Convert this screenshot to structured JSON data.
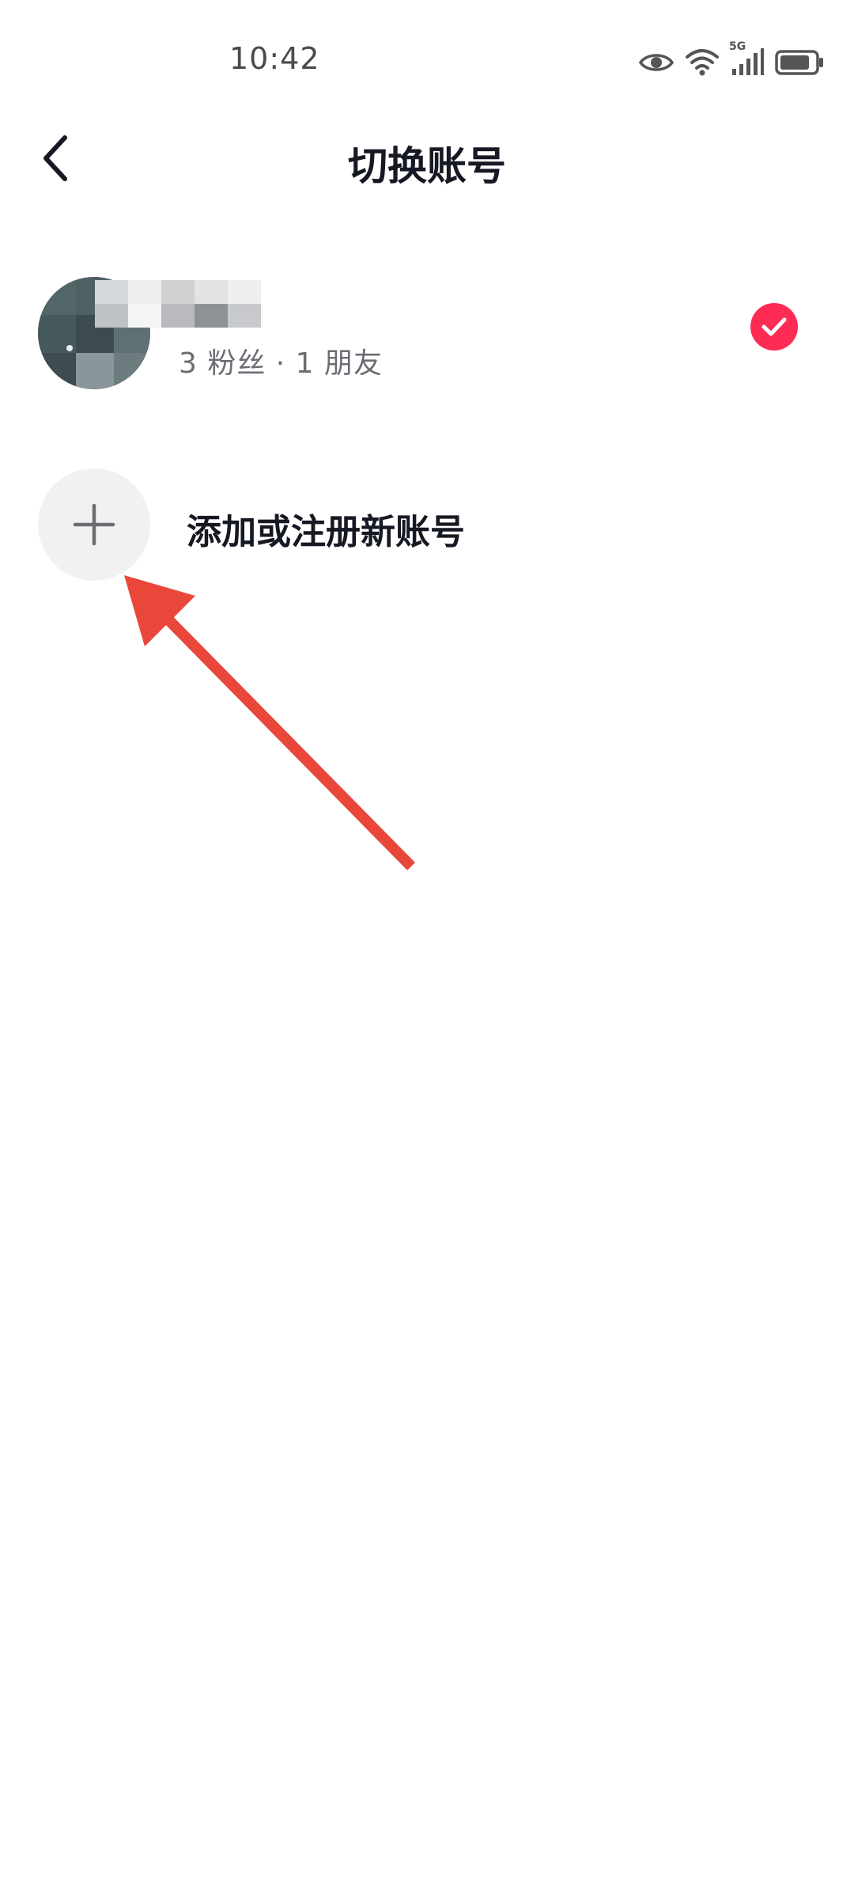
{
  "status_bar": {
    "time": "10:42",
    "icons": [
      "eye-icon",
      "wifi-icon",
      "5g-icon",
      "signal-icon",
      "battery-icon"
    ],
    "network_label": "5G"
  },
  "header": {
    "title": "切换账号",
    "back_icon": "chevron-left-icon"
  },
  "accounts": [
    {
      "stats": "3 粉丝 · 1 朋友",
      "selected": true
    }
  ],
  "add_account": {
    "label": "添加或注册新账号",
    "icon": "plus-icon"
  },
  "colors": {
    "accent": "#fe2c55",
    "annotation": "#e8473a",
    "title_text": "#161823",
    "secondary_text": "#6b6d75",
    "add_circle_bg": "#f1f1f2"
  }
}
